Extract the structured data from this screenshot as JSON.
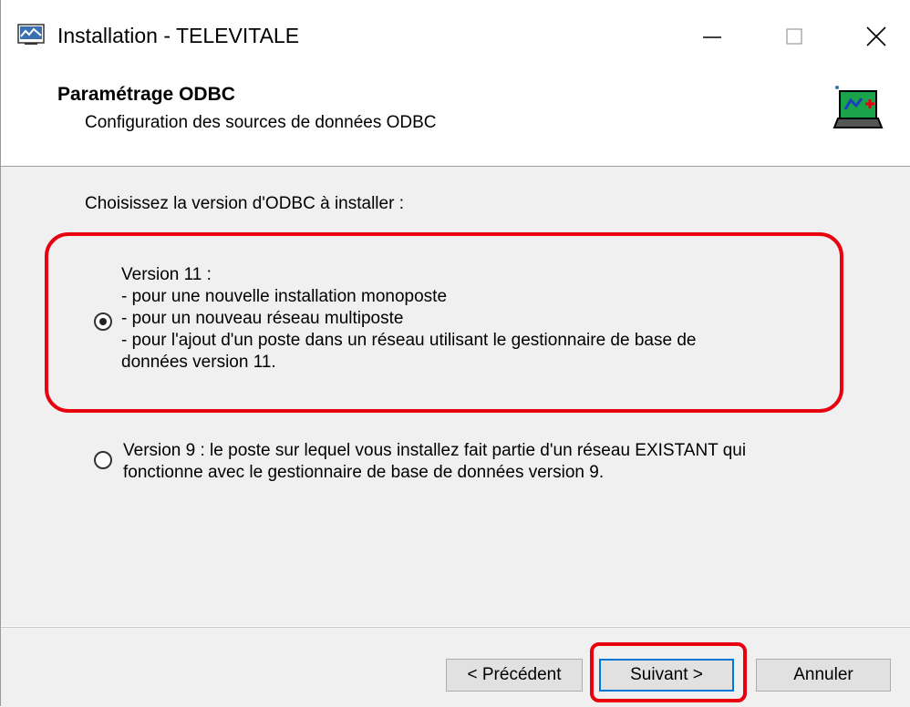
{
  "window": {
    "title": "Installation - TELEVITALE",
    "controls": [
      "minimize",
      "maximize",
      "close"
    ]
  },
  "header": {
    "title": "Paramétrage ODBC",
    "subtitle": "Configuration des sources de données ODBC",
    "icon": "installer-computer-icon"
  },
  "content": {
    "prompt": "Choisissez la version d'ODBC à installer :",
    "options": [
      {
        "id": "version-11",
        "selected": true,
        "lines": [
          "Version 11 :",
          "- pour une nouvelle installation monoposte",
          "- pour un nouveau réseau multiposte",
          "- pour l'ajout d'un poste dans un réseau utilisant le gestionnaire de base de",
          "données version 11."
        ]
      },
      {
        "id": "version-9",
        "selected": false,
        "lines": [
          "Version 9 : le poste sur lequel vous installez fait partie d'un réseau EXISTANT qui",
          "fonctionne avec le gestionnaire de base de données version 9."
        ]
      }
    ]
  },
  "footer": {
    "prev_label": "< Précédent",
    "next_label": "Suivant >",
    "cancel_label": "Annuler"
  },
  "colors": {
    "highlight": "#e8000e",
    "focus_border": "#0078d7",
    "panel_bg": "#f0f0f0"
  }
}
